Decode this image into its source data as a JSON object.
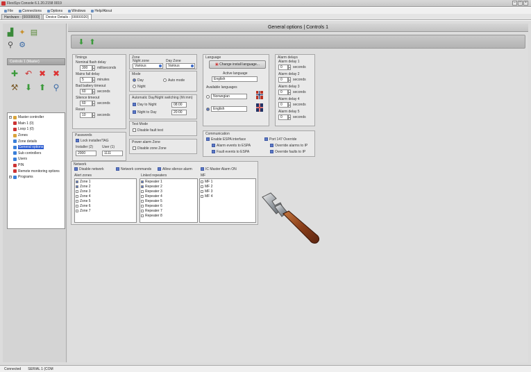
{
  "window": {
    "title": "FlexiSys Console 6.1.20.2158 0019"
  },
  "menubar": {
    "items": [
      {
        "label": "File"
      },
      {
        "label": "Connections"
      },
      {
        "label": "Options"
      },
      {
        "label": "Windows"
      },
      {
        "label": "Help/About"
      }
    ]
  },
  "tabs": [
    {
      "label": "Hardware - [00000000]"
    },
    {
      "label": "Device Details - [00000020]"
    }
  ],
  "left": {
    "controller_header": "Controls 1 (Master)"
  },
  "tree": {
    "items": [
      {
        "label": "Master controller",
        "level": 0,
        "icon": "folder-icon",
        "color": "#d9a33a",
        "selected": false
      },
      {
        "label": "Main 1 (0)",
        "level": 1,
        "icon": "device-icon",
        "color": "#c33",
        "selected": false
      },
      {
        "label": "Loop 1 (0)",
        "level": 1,
        "icon": "device-icon",
        "color": "#c33",
        "selected": false
      },
      {
        "label": "Zones",
        "level": 1,
        "icon": "zone-icon",
        "color": "#d9a33a",
        "selected": false
      },
      {
        "label": "Zone details",
        "level": 1,
        "icon": "detail-icon",
        "color": "#3a7fd9",
        "selected": false
      },
      {
        "label": "General options",
        "level": 1,
        "icon": "options-icon",
        "color": "#3a7fd9",
        "selected": true
      },
      {
        "label": "Sub controllers",
        "level": 1,
        "icon": "network-icon",
        "color": "#3a7fd9",
        "selected": false
      },
      {
        "label": "Users",
        "level": 1,
        "icon": "user-icon",
        "color": "#3a7fd9",
        "selected": false
      },
      {
        "label": "PIN",
        "level": 1,
        "icon": "pin-icon",
        "color": "#c33",
        "selected": false
      },
      {
        "label": "Remote monitoring options",
        "level": 1,
        "icon": "monitor-icon",
        "color": "#c33",
        "selected": false
      },
      {
        "label": "Programs",
        "level": 0,
        "icon": "program-icon",
        "color": "#3a7fd9",
        "selected": false
      }
    ]
  },
  "content": {
    "header": "General options | Controls 1"
  },
  "timings": {
    "title": "Timings",
    "nominal_label": "Nominal flash delay",
    "nominal_value": "300",
    "nominal_unit": "milliseconds",
    "min_panel_label": "Mains fail delay",
    "min_panel_value": "5",
    "min_panel_unit": "minutes",
    "battery_label": "Bad battery timeout",
    "battery_value": "60",
    "battery_unit": "seconds",
    "sprinkler_label": "Silence timeout",
    "sprinkler_value": "60",
    "sprinkler_unit": "seconds",
    "reset_label": "Reset",
    "reset_value": "10",
    "reset_unit": "seconds"
  },
  "zone": {
    "title": "Zone",
    "night_label": "Night zone",
    "night_value": "Various",
    "day_label": "Day Zone",
    "day_value": "Various"
  },
  "mode": {
    "title": "Mode",
    "opt_day": "Day",
    "opt_auto": "Auto mode",
    "opt_night": "Night"
  },
  "auto_mode": {
    "title": "Automatic Day/Night switching (hh:mm)",
    "day_label": "Day to Night",
    "day_value": "08:00",
    "night_label": "Night to Day",
    "night_value": "20:00"
  },
  "test": {
    "title": "Test Mode",
    "label": "Disable fault test"
  },
  "test_zone": {
    "title": "Power alarm Zone",
    "label": "Disable zone Zone"
  },
  "password": {
    "title": "Passwords",
    "lock_label": "Lock installer/TAG",
    "installer_label": "Installer (2)",
    "installer_value": "2000",
    "user_label": "User (1)",
    "user_value": "1111"
  },
  "language": {
    "title": "Language",
    "change_button": "Change install language...",
    "active_label": "Active language",
    "active_value": "English",
    "available_title": "Available languages",
    "lang1": "Norwegian",
    "lang2": "English"
  },
  "alarm_delays": {
    "title": "Alarm delays",
    "d1_label": "Alarm delay 1",
    "d1_value": "0",
    "d1_unit": "seconds",
    "d2_label": "Alarm delay 2",
    "d2_value": "0",
    "d2_unit": "seconds",
    "d3_label": "Alarm delay 3",
    "d3_value": "0",
    "d3_unit": "seconds",
    "d4_label": "Alarm delay 4",
    "d4_value": "0",
    "d4_unit": "seconds",
    "d5_label": "Alarm delay 5",
    "d5_value": "0",
    "d5_unit": "seconds"
  },
  "comm": {
    "title": "Communication",
    "c1": "Enable ESPA interface",
    "c2": "Alarm events to ESPA",
    "c3": "Fault events to ESPA",
    "r1": "Port 147 Override",
    "r2": "Override alarms to IP",
    "r3": "Override faults to IP"
  },
  "network": {
    "title": "Network",
    "o1": "Disable network",
    "o2": "Network commands",
    "o3": "Allow silence alarm",
    "o4": "IC Master Alarm ON",
    "zone_title": "Alert zones",
    "zones": [
      {
        "label": "Zone 1",
        "checked": true
      },
      {
        "label": "Zone 2",
        "checked": true
      },
      {
        "label": "Zone 3",
        "checked": false
      },
      {
        "label": "Zone 4",
        "checked": false
      },
      {
        "label": "Zone 5",
        "checked": false
      },
      {
        "label": "Zone 6",
        "checked": false
      },
      {
        "label": "Zone 7",
        "checked": false
      }
    ],
    "repeater_title": "Linked repeaters",
    "repeaters": [
      {
        "label": "Repeater 1",
        "checked": true
      },
      {
        "label": "Repeater 2",
        "checked": true
      },
      {
        "label": "Repeater 3",
        "checked": false
      },
      {
        "label": "Repeater 4",
        "checked": false
      },
      {
        "label": "Repeater 5",
        "checked": false
      },
      {
        "label": "Repeater 6",
        "checked": false
      },
      {
        "label": "Repeater 7",
        "checked": false
      },
      {
        "label": "Repeater 8",
        "checked": false
      }
    ],
    "mf_title": "MF",
    "mfs": [
      {
        "label": "MF 1",
        "checked": false
      },
      {
        "label": "MF 2",
        "checked": false
      },
      {
        "label": "MF 3",
        "checked": false
      },
      {
        "label": "MF 4",
        "checked": false
      }
    ]
  },
  "status": {
    "left": "Connected",
    "right": "SERIAL 1 (COM"
  }
}
